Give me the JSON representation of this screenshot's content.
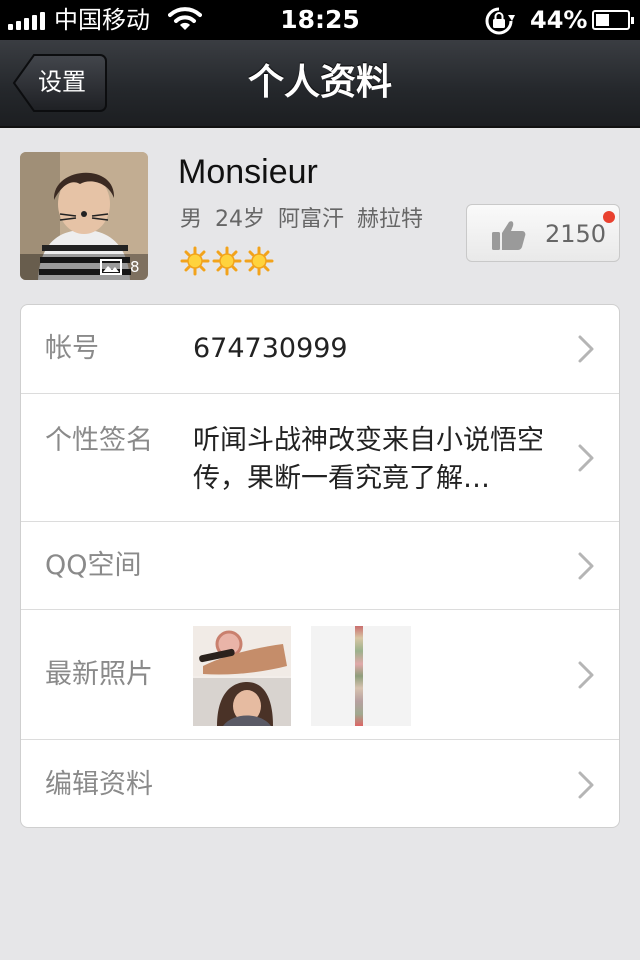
{
  "status_bar": {
    "carrier": "中国移动",
    "time": "18:25",
    "battery_percent": "44%",
    "battery_level": 0.44,
    "icons": [
      "signal-icon",
      "wifi-icon",
      "rotation-lock-icon",
      "battery-icon"
    ]
  },
  "nav": {
    "back_label": "设置",
    "title": "个人资料"
  },
  "profile": {
    "name": "Monsieur",
    "meta": "男 24岁 阿富汗 赫拉特",
    "photo_count": "8",
    "level_icons": [
      "sun-icon",
      "sun-icon",
      "sun-icon"
    ],
    "likes": "2150",
    "like_badge_color": "#e9412f"
  },
  "rows": {
    "account": {
      "label": "帐号",
      "value": "674730999"
    },
    "signature": {
      "label": "个性签名",
      "value": "听闻斗战神改变来自小说悟空传，果断一看究竟了解…"
    },
    "qzone": {
      "label": "QQ空间"
    },
    "photos": {
      "label": "最新照片"
    },
    "edit": {
      "label": "编辑资料"
    }
  }
}
